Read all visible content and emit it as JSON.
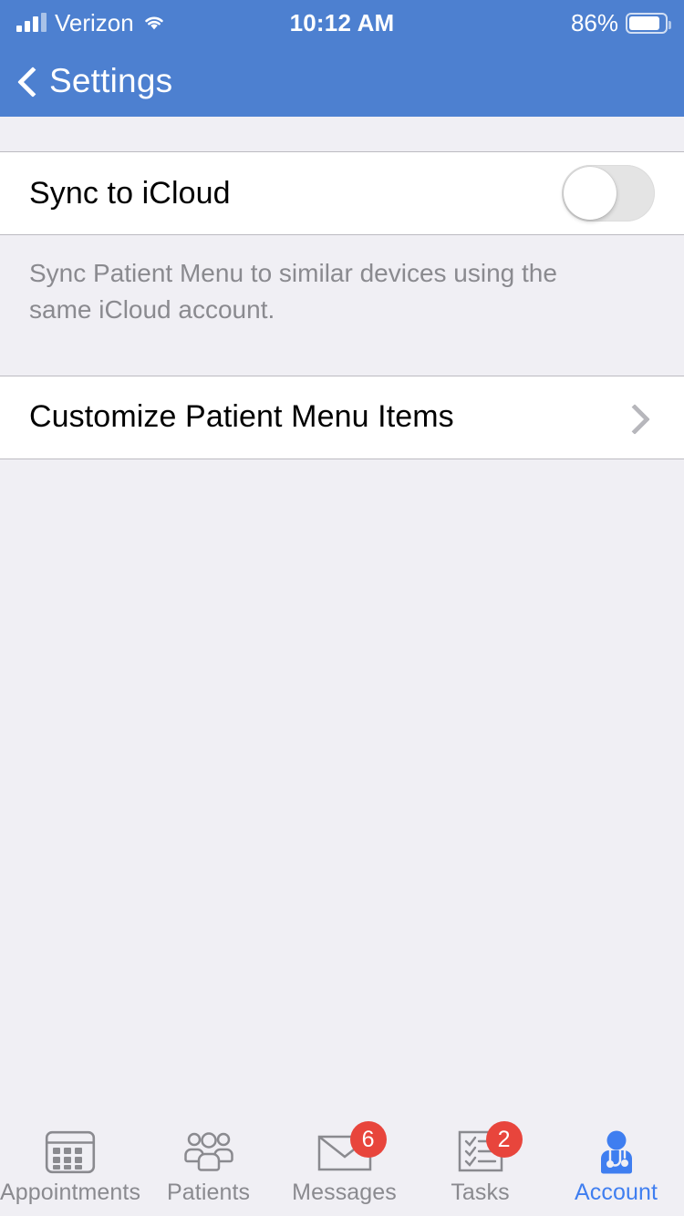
{
  "status_bar": {
    "carrier": "Verizon",
    "time": "10:12 AM",
    "battery_percent": "86%",
    "battery_level": 86,
    "signal_bars_filled": 3,
    "signal_bars_total": 4,
    "wifi_icon": "wifi-icon",
    "battery_icon": "battery-icon"
  },
  "navbar": {
    "back_icon": "chevron-left-icon",
    "title": "Settings",
    "background_color": "#4d80d0",
    "text_color": "#ffffff"
  },
  "settings": {
    "sync_row": {
      "label": "Sync to iCloud",
      "toggle_state": "off",
      "toggle_name": "sync-to-icloud-toggle"
    },
    "sync_footnote": "Sync Patient Menu to similar devices using the same iCloud account.",
    "customize_row": {
      "label": "Customize Patient Menu Items",
      "disclosure_icon": "chevron-right-icon"
    }
  },
  "tabbar": {
    "active_tab": "Account",
    "active_color": "#3f7ef0",
    "inactive_color": "#8a8a8f",
    "badge_color": "#e8453c",
    "tabs": [
      {
        "label": "Appointments",
        "icon": "calendar-icon",
        "badge": ""
      },
      {
        "label": "Patients",
        "icon": "people-group-icon",
        "badge": ""
      },
      {
        "label": "Messages",
        "icon": "envelope-icon",
        "badge": "6"
      },
      {
        "label": "Tasks",
        "icon": "checklist-icon",
        "badge": "2"
      },
      {
        "label": "Account",
        "icon": "doctor-icon",
        "badge": ""
      }
    ]
  }
}
